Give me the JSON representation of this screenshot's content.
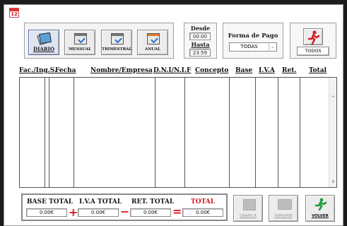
{
  "periods": [
    {
      "label": "DIARIO",
      "accel": "D",
      "rest": "IARIO"
    },
    {
      "label": "MENSUAL",
      "accel": "M",
      "rest": "ENSUAL"
    },
    {
      "label": "TRIMESTRAL",
      "accel": "T",
      "rest": "RIMESTRAL"
    },
    {
      "label": "ANUAL",
      "accel": "A",
      "rest": "NUAL"
    }
  ],
  "app_icon_day": "12",
  "dates": {
    "desde_label": "Desde",
    "desde_value": "00:00",
    "hasta_label": "Hasta",
    "hasta_value": "23:59"
  },
  "payment": {
    "label": "Forma de Pago",
    "selected": "TODAS"
  },
  "todos_label": "TODOS",
  "columns": [
    "Fac./Ing.S.",
    "Fecha",
    "Nombre/Empresa",
    "D.N.I/N.I.F",
    "Concepto",
    "Base",
    "I.V.A",
    "Ret.",
    "Total"
  ],
  "totals": {
    "base_label": "BASE TOTAL",
    "base_value": "0.00€",
    "iva_label": "I.V.A TOTAL",
    "iva_value": "0.00€",
    "ret_label": "RET. TOTAL",
    "ret_value": "0.00€",
    "total_label": "TOTAL",
    "total_value": "0.00€",
    "plus": "+",
    "minus": "−",
    "equals": "="
  },
  "actions": {
    "grafica": "GRAFICA",
    "imprimir": "IMPRIMIR",
    "volver": "VOLVER",
    "volver_accel": "V",
    "volver_rest": "OLVER"
  },
  "colors": {
    "accent_red": "#e0192b",
    "total_red": "#d11a1a",
    "disabled": "#9a9a9a"
  }
}
